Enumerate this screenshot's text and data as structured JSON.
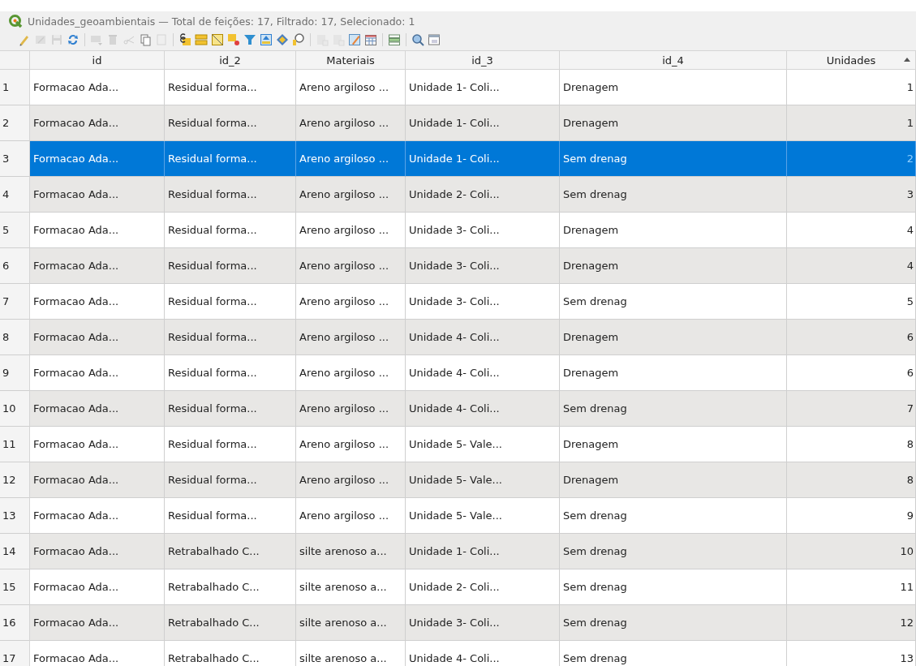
{
  "window": {
    "title": "Unidades_geoambientais — Total de feições: 17, Filtrado: 17, Selecionado: 1"
  },
  "toolbar": [
    {
      "buttons": [
        {
          "kind": "pencil",
          "disabled": false
        },
        {
          "kind": "multiedit",
          "disabled": true
        },
        {
          "kind": "save",
          "disabled": true
        },
        {
          "kind": "reload",
          "disabled": false
        }
      ]
    },
    {
      "buttons": [
        {
          "kind": "addrow",
          "disabled": true
        },
        {
          "kind": "delete",
          "disabled": true
        },
        {
          "kind": "cut",
          "disabled": true
        },
        {
          "kind": "copy",
          "disabled": false
        },
        {
          "kind": "paste",
          "disabled": true
        }
      ]
    },
    {
      "buttons": [
        {
          "kind": "expression",
          "disabled": false
        },
        {
          "kind": "selectall",
          "disabled": false
        },
        {
          "kind": "invert",
          "disabled": false
        },
        {
          "kind": "deselect",
          "disabled": false
        },
        {
          "kind": "filter",
          "disabled": false
        },
        {
          "kind": "movetop",
          "disabled": false
        },
        {
          "kind": "pan",
          "disabled": false
        },
        {
          "kind": "zoomsel",
          "disabled": false
        }
      ]
    },
    {
      "buttons": [
        {
          "kind": "newfield",
          "disabled": true
        },
        {
          "kind": "delfield",
          "disabled": true
        },
        {
          "kind": "editfield",
          "disabled": false
        },
        {
          "kind": "calculator",
          "disabled": false
        }
      ]
    },
    {
      "buttons": [
        {
          "kind": "conditional",
          "disabled": false
        }
      ]
    },
    {
      "buttons": [
        {
          "kind": "actions",
          "disabled": false
        },
        {
          "kind": "form",
          "disabled": false
        }
      ]
    }
  ],
  "table": {
    "columns": [
      {
        "label": "id",
        "sorted": false
      },
      {
        "label": "id_2",
        "sorted": false
      },
      {
        "label": "Materiais",
        "sorted": false
      },
      {
        "label": "id_3",
        "sorted": false
      },
      {
        "label": "id_4",
        "sorted": false
      },
      {
        "label": "Unidades",
        "sorted": true
      }
    ],
    "rows": [
      {
        "number": "1",
        "selected": false,
        "cells": [
          "Formacao Ada...",
          "Residual forma...",
          "Areno argiloso ...",
          "Unidade 1- Coli...",
          "Drenagem",
          "1"
        ]
      },
      {
        "number": "2",
        "selected": false,
        "cells": [
          "Formacao Ada...",
          "Residual forma...",
          "Areno argiloso ...",
          "Unidade 1- Coli...",
          "Drenagem",
          "1"
        ]
      },
      {
        "number": "3",
        "selected": true,
        "cells": [
          "Formacao Ada...",
          "Residual forma...",
          "Areno argiloso ...",
          "Unidade 1- Coli...",
          "Sem drenag",
          "2"
        ]
      },
      {
        "number": "4",
        "selected": false,
        "cells": [
          "Formacao Ada...",
          "Residual forma...",
          "Areno argiloso ...",
          "Unidade 2- Coli...",
          "Sem drenag",
          "3"
        ]
      },
      {
        "number": "5",
        "selected": false,
        "cells": [
          "Formacao Ada...",
          "Residual forma...",
          "Areno argiloso ...",
          "Unidade 3- Coli...",
          "Drenagem",
          "4"
        ]
      },
      {
        "number": "6",
        "selected": false,
        "cells": [
          "Formacao Ada...",
          "Residual forma...",
          "Areno argiloso ...",
          "Unidade 3- Coli...",
          "Drenagem",
          "4"
        ]
      },
      {
        "number": "7",
        "selected": false,
        "cells": [
          "Formacao Ada...",
          "Residual forma...",
          "Areno argiloso ...",
          "Unidade 3- Coli...",
          "Sem drenag",
          "5"
        ]
      },
      {
        "number": "8",
        "selected": false,
        "cells": [
          "Formacao Ada...",
          "Residual forma...",
          "Areno argiloso ...",
          "Unidade 4- Coli...",
          "Drenagem",
          "6"
        ]
      },
      {
        "number": "9",
        "selected": false,
        "cells": [
          "Formacao Ada...",
          "Residual forma...",
          "Areno argiloso ...",
          "Unidade 4- Coli...",
          "Drenagem",
          "6"
        ]
      },
      {
        "number": "10",
        "selected": false,
        "cells": [
          "Formacao Ada...",
          "Residual forma...",
          "Areno argiloso ...",
          "Unidade 4- Coli...",
          "Sem drenag",
          "7"
        ]
      },
      {
        "number": "11",
        "selected": false,
        "cells": [
          "Formacao Ada...",
          "Residual forma...",
          "Areno argiloso ...",
          "Unidade 5- Vale...",
          "Drenagem",
          "8"
        ]
      },
      {
        "number": "12",
        "selected": false,
        "cells": [
          "Formacao Ada...",
          "Residual forma...",
          "Areno argiloso ...",
          "Unidade 5- Vale...",
          "Drenagem",
          "8"
        ]
      },
      {
        "number": "13",
        "selected": false,
        "cells": [
          "Formacao Ada...",
          "Residual forma...",
          "Areno argiloso ...",
          "Unidade 5- Vale...",
          "Sem drenag",
          "9"
        ]
      },
      {
        "number": "14",
        "selected": false,
        "cells": [
          "Formacao Ada...",
          "Retrabalhado C...",
          "silte arenoso a...",
          "Unidade 1- Coli...",
          "Sem drenag",
          "10"
        ]
      },
      {
        "number": "15",
        "selected": false,
        "cells": [
          "Formacao Ada...",
          "Retrabalhado C...",
          "silte arenoso a...",
          "Unidade 2- Coli...",
          "Sem drenag",
          "11"
        ]
      },
      {
        "number": "16",
        "selected": false,
        "cells": [
          "Formacao Ada...",
          "Retrabalhado C...",
          "silte arenoso a...",
          "Unidade 3- Coli...",
          "Sem drenag",
          "12"
        ]
      },
      {
        "number": "17",
        "selected": false,
        "cells": [
          "Formacao Ada...",
          "Retrabalhado C...",
          "silte arenoso a...",
          "Unidade 4- Coli...",
          "Sem drenag",
          "13"
        ]
      }
    ]
  }
}
